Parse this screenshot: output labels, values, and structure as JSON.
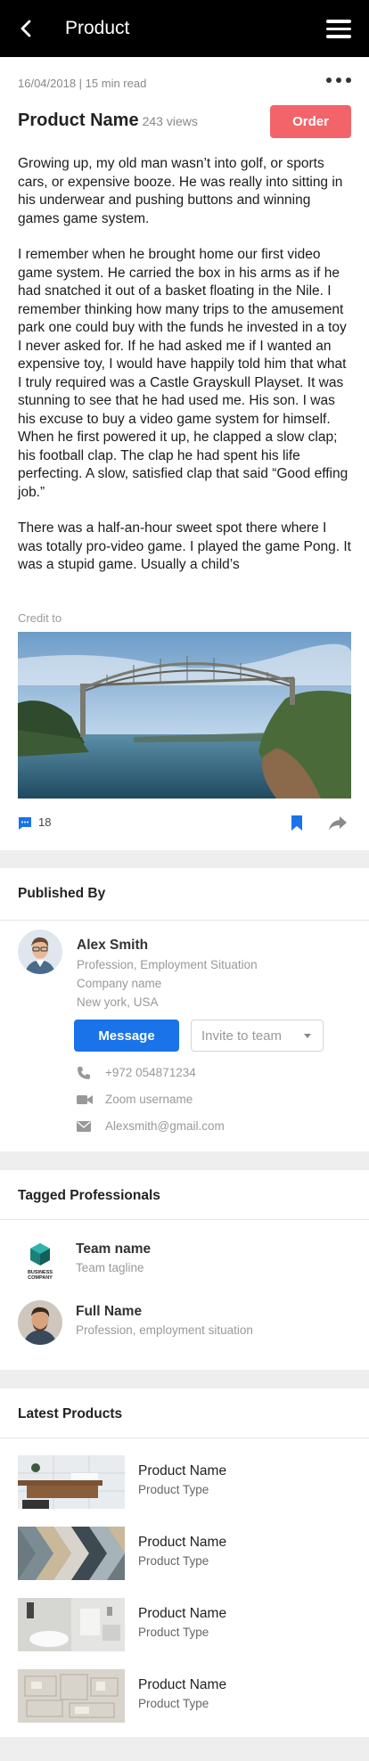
{
  "topbar": {
    "title": "Product"
  },
  "article": {
    "meta": "16/04/2018 | 15 min read",
    "product_name": "Product Name",
    "views": "243 views",
    "order_label": "Order",
    "paragraphs": [
      "Growing up, my old man wasn’t into golf, or sports cars, or expensive booze. He was really into sitting in his underwear and pushing buttons and winning games game system.",
      "I remember when he brought home our first video game system. He carried the box in his arms as if he had snatched it out of a basket floating in the Nile. I remember thinking how many trips to the amusement park one could buy with the funds he invested in a toy I never asked for. If he had asked me if I wanted an expensive toy, I would have happily told him that what I truly required was a Castle Grayskull Playset. It was stunning to see that he had used me. His son. I was his excuse to buy a video game system for himself. When he first powered it up, he clapped a slow clap; his football clap. The clap he had spent his life perfecting. A slow, satisfied clap that said “Good effing job.”",
      "There was a half-an-hour sweet spot there where I was totally pro-video game. I played the game Pong. It was a stupid game. Usually a child’s"
    ],
    "credit": "Credit to",
    "comment_count": "18"
  },
  "published": {
    "title": "Published By",
    "name": "Alex Smith",
    "profession": "Profession, Employment Situation",
    "company": "Company name",
    "location": "New york, USA",
    "message_label": "Message",
    "invite_label": "Invite to team",
    "phone": "+972 054871234",
    "zoom": "Zoom username",
    "email": "Alexsmith@gmail.com"
  },
  "tagged": {
    "title": "Tagged Professionals",
    "team_logo_line1": "BUSINESS",
    "team_logo_line2": "COMPANY",
    "team_name": "Team name",
    "team_tagline": "Team tagline",
    "person_name": "Full Name",
    "person_sub": "Profession, employment situation"
  },
  "latest": {
    "title": "Latest Products",
    "items": [
      {
        "name": "Product Name",
        "type": "Product Type"
      },
      {
        "name": "Product Name",
        "type": "Product Type"
      },
      {
        "name": "Product Name",
        "type": "Product Type"
      },
      {
        "name": "Product Name",
        "type": "Product Type"
      }
    ]
  },
  "colors": {
    "accent_blue": "#1a73e8",
    "order_red": "#f2646a",
    "topbar": "#000000"
  },
  "icons": [
    "back-arrow-icon",
    "hamburger-menu-icon",
    "more-dots-icon",
    "comment-icon",
    "bookmark-icon",
    "share-icon",
    "phone-icon",
    "video-icon",
    "mail-icon"
  ]
}
